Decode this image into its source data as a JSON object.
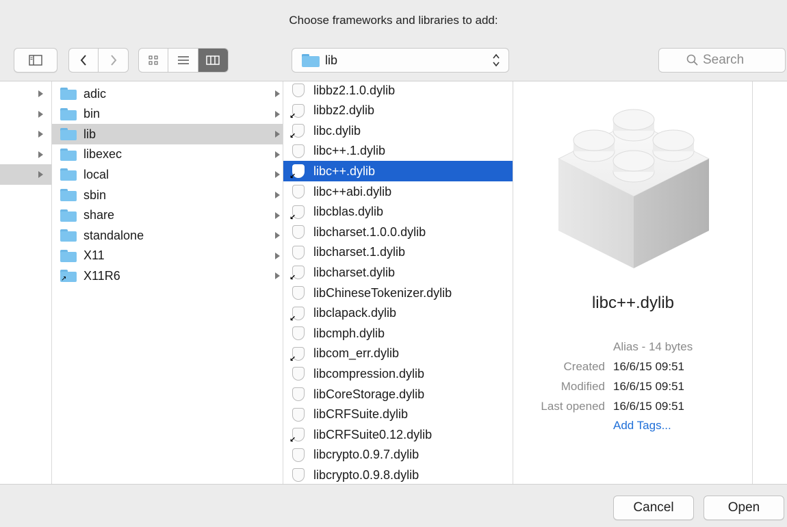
{
  "dialog": {
    "title": "Choose frameworks and libraries to add:"
  },
  "toolbar": {
    "path": {
      "current": "lib"
    },
    "search": {
      "placeholder": "Search"
    }
  },
  "sidebar_column": {
    "selected_index": 4
  },
  "folders": [
    {
      "name": "adic",
      "has_children": true
    },
    {
      "name": "bin",
      "has_children": true
    },
    {
      "name": "lib",
      "has_children": true,
      "selected": true
    },
    {
      "name": "libexec",
      "has_children": true
    },
    {
      "name": "local",
      "has_children": true
    },
    {
      "name": "sbin",
      "has_children": true
    },
    {
      "name": "share",
      "has_children": true
    },
    {
      "name": "standalone",
      "has_children": true
    },
    {
      "name": "X11",
      "has_children": true
    },
    {
      "name": "X11R6",
      "has_children": true,
      "alias": true
    }
  ],
  "libraries": [
    {
      "name": "libbz2.1.0.dylib",
      "alias": false
    },
    {
      "name": "libbz2.dylib",
      "alias": true
    },
    {
      "name": "libc.dylib",
      "alias": true
    },
    {
      "name": "libc++.1.dylib",
      "alias": false
    },
    {
      "name": "libc++.dylib",
      "alias": true,
      "selected": true
    },
    {
      "name": "libc++abi.dylib",
      "alias": false
    },
    {
      "name": "libcblas.dylib",
      "alias": true
    },
    {
      "name": "libcharset.1.0.0.dylib",
      "alias": false
    },
    {
      "name": "libcharset.1.dylib",
      "alias": false
    },
    {
      "name": "libcharset.dylib",
      "alias": true
    },
    {
      "name": "libChineseTokenizer.dylib",
      "alias": false
    },
    {
      "name": "libclapack.dylib",
      "alias": true
    },
    {
      "name": "libcmph.dylib",
      "alias": false
    },
    {
      "name": "libcom_err.dylib",
      "alias": true
    },
    {
      "name": "libcompression.dylib",
      "alias": false
    },
    {
      "name": "libCoreStorage.dylib",
      "alias": false
    },
    {
      "name": "libCRFSuite.dylib",
      "alias": false
    },
    {
      "name": "libCRFSuite0.12.dylib",
      "alias": true
    },
    {
      "name": "libcrypto.0.9.7.dylib",
      "alias": false
    },
    {
      "name": "libcrypto.0.9.8.dylib",
      "alias": false
    }
  ],
  "preview": {
    "name": "libc++.dylib",
    "kind": "Alias - 14 bytes",
    "created_label": "Created",
    "created": "16/6/15 09:51",
    "modified_label": "Modified",
    "modified": "16/6/15 09:51",
    "last_opened_label": "Last opened",
    "last_opened": "16/6/15 09:51",
    "add_tags": "Add Tags..."
  },
  "footer": {
    "cancel_label": "Cancel",
    "open_label": "Open"
  },
  "colors": {
    "selection_blue": "#1e63d0",
    "link_blue": "#1f6fd8",
    "folder_blue": "#7cc4ef"
  }
}
